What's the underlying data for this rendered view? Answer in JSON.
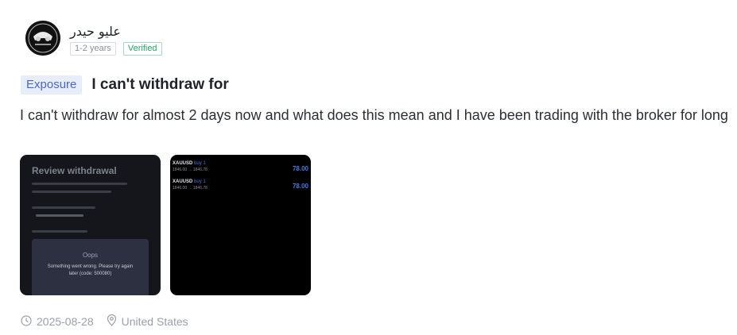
{
  "user": {
    "name": "عليو حيدر",
    "experience": "1-2 years",
    "verified": "Verified"
  },
  "post": {
    "category": "Exposure",
    "title": "I can't withdraw for",
    "body": "I can't withdraw for almost 2 days now and what does this mean and I have been trading with the broker for long",
    "date": "2025-08-28",
    "location": "United States"
  },
  "thumbnails": {
    "first": {
      "heading": "Review withdrawal",
      "modal_title": "Oops",
      "modal_message": "Something went wrong. Please try again later (code: 500080)"
    },
    "second": {
      "trades": [
        {
          "symbol": "XAUUSD",
          "side": "buy 1",
          "detail": "1846.00 → 1846.78",
          "pnl": "78.00"
        },
        {
          "symbol": "XAUUSD",
          "side": "buy 1",
          "detail": "1846.00 → 1846.78",
          "pnl": "78.00"
        }
      ]
    }
  },
  "icons": {
    "date": "clock-icon",
    "location": "location-pin-icon"
  },
  "colors": {
    "badge_bg": "#e8edfb",
    "badge_text": "#4a66c9",
    "verified": "#2aa36b"
  }
}
